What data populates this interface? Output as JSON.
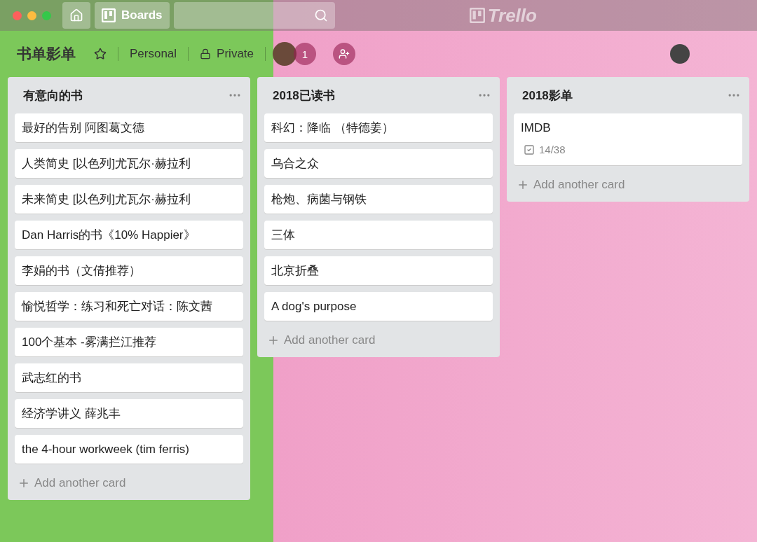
{
  "topbar": {
    "boards_label": "Boards",
    "logo": "Trello"
  },
  "board": {
    "title": "书单影单",
    "starred": false,
    "team": "Personal",
    "visibility": "Private",
    "member_count": "1"
  },
  "lists": [
    {
      "title": "有意向的书",
      "add_label": "Add another card",
      "cards": [
        {
          "title": "最好的告别 阿图葛文德"
        },
        {
          "title": "人类简史 [以色列]尤瓦尔·赫拉利"
        },
        {
          "title": "未来简史 [以色列]尤瓦尔·赫拉利"
        },
        {
          "title": "Dan Harris的书《10% Happier》"
        },
        {
          "title": "李娟的书（文倩推荐）"
        },
        {
          "title": "愉悦哲学：练习和死亡对话：陈文茜"
        },
        {
          "title": "100个基本 -雾满拦江推荐"
        },
        {
          "title": "武志红的书"
        },
        {
          "title": "经济学讲义 薛兆丰"
        },
        {
          "title": "the 4-hour workweek (tim ferris)"
        }
      ]
    },
    {
      "title": "2018已读书",
      "add_label": "Add another card",
      "cards": [
        {
          "title": "科幻：降临 （特德姜）"
        },
        {
          "title": "乌合之众"
        },
        {
          "title": "枪炮、病菌与钢铁"
        },
        {
          "title": "三体"
        },
        {
          "title": "北京折叠"
        },
        {
          "title": "A dog's purpose"
        }
      ]
    },
    {
      "title": "2018影单",
      "add_label": "Add another card",
      "cards": [
        {
          "title": "IMDB",
          "checklist": "14/38"
        }
      ]
    }
  ]
}
